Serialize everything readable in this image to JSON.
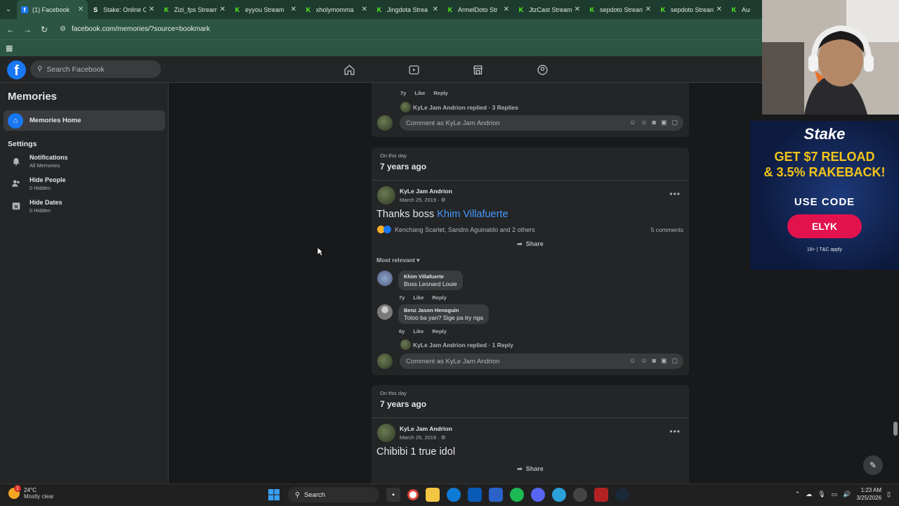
{
  "browser": {
    "tabs": [
      {
        "label": "(1) Facebook",
        "icon": "facebook-icon",
        "active": true
      },
      {
        "label": "Stake: Online C",
        "icon": "stake-icon"
      },
      {
        "label": "Zizi_fps Stream",
        "icon": "kick-icon"
      },
      {
        "label": "eyyou Stream",
        "icon": "kick-icon"
      },
      {
        "label": "xholymomma",
        "icon": "kick-icon"
      },
      {
        "label": "Jingdota Strea",
        "icon": "kick-icon"
      },
      {
        "label": "ArmelDoto Str",
        "icon": "kick-icon"
      },
      {
        "label": "JtzCast Stream",
        "icon": "kick-icon"
      },
      {
        "label": "sepdoto Strean",
        "icon": "kick-icon"
      },
      {
        "label": "sepdoto Strean",
        "icon": "kick-icon"
      },
      {
        "label": "Aurora",
        "icon": "kick-icon"
      }
    ],
    "url": "facebook.com/memories/?source=bookmark"
  },
  "fb": {
    "search_placeholder": "Search Facebook"
  },
  "sidebar": {
    "title": "Memories",
    "home": "Memories Home",
    "settings_heading": "Settings",
    "items": [
      {
        "title": "Notifications",
        "sub": "All Memories"
      },
      {
        "title": "Hide People",
        "sub": "0 Hidden"
      },
      {
        "title": "Hide Dates",
        "sub": "0 Hidden"
      }
    ]
  },
  "top_card": {
    "reply_time": "7y",
    "like": "Like",
    "reply": "Reply",
    "replied_text": "KyLe Jam Andrion replied · 3 Replies",
    "comment_placeholder": "Comment as KyLe Jam Andrion"
  },
  "memory1": {
    "on_this_day": "On this day",
    "years_ago": "7 years ago",
    "author": "KyLe Jam Andrion",
    "date": "March 25, 2019 ·",
    "text_prefix": "Thanks boss ",
    "mention": "Khim Villafuerte",
    "reactions": "Kenchang Scarlet, Sandro Aguinaldo and 2 others",
    "comments_count": "5 comments",
    "share": "Share",
    "sort": "Most relevant",
    "comments": [
      {
        "name": "Khim Villafuerte",
        "text": "Boss Leonard Louie",
        "time": "7y"
      },
      {
        "name": "Benz Jason Henoguin",
        "text": "Totoo ba yan? Sige pa try nga",
        "time": "6y"
      }
    ],
    "replied_text": "KyLe Jam Andrion replied · 1 Reply",
    "comment_placeholder": "Comment as KyLe Jam Andrion"
  },
  "memory2": {
    "on_this_day": "On this day",
    "years_ago": "7 years ago",
    "author": "KyLe Jam Andrion",
    "date": "March 25, 2019 ·",
    "text": "Chibibi 1 true idol",
    "share": "Share"
  },
  "ad": {
    "brand": "Stake",
    "promo_line1": "GET $7 RELOAD",
    "promo_line2": "& 3.5% RAKEBACK!",
    "use_code": "USE CODE",
    "code": "ELYK",
    "terms": "18+ | T&C apply"
  },
  "taskbar": {
    "temp": "24°C",
    "weather": "Mostly clear",
    "search": "Search",
    "time": "1:23 AM",
    "date": "3/25/2026",
    "weather_badge": "1"
  },
  "colors": {
    "accent": "#1877f2",
    "mention": "#4599ff",
    "browser_bar": "#2c5543",
    "stake_button": "#e2124f"
  }
}
